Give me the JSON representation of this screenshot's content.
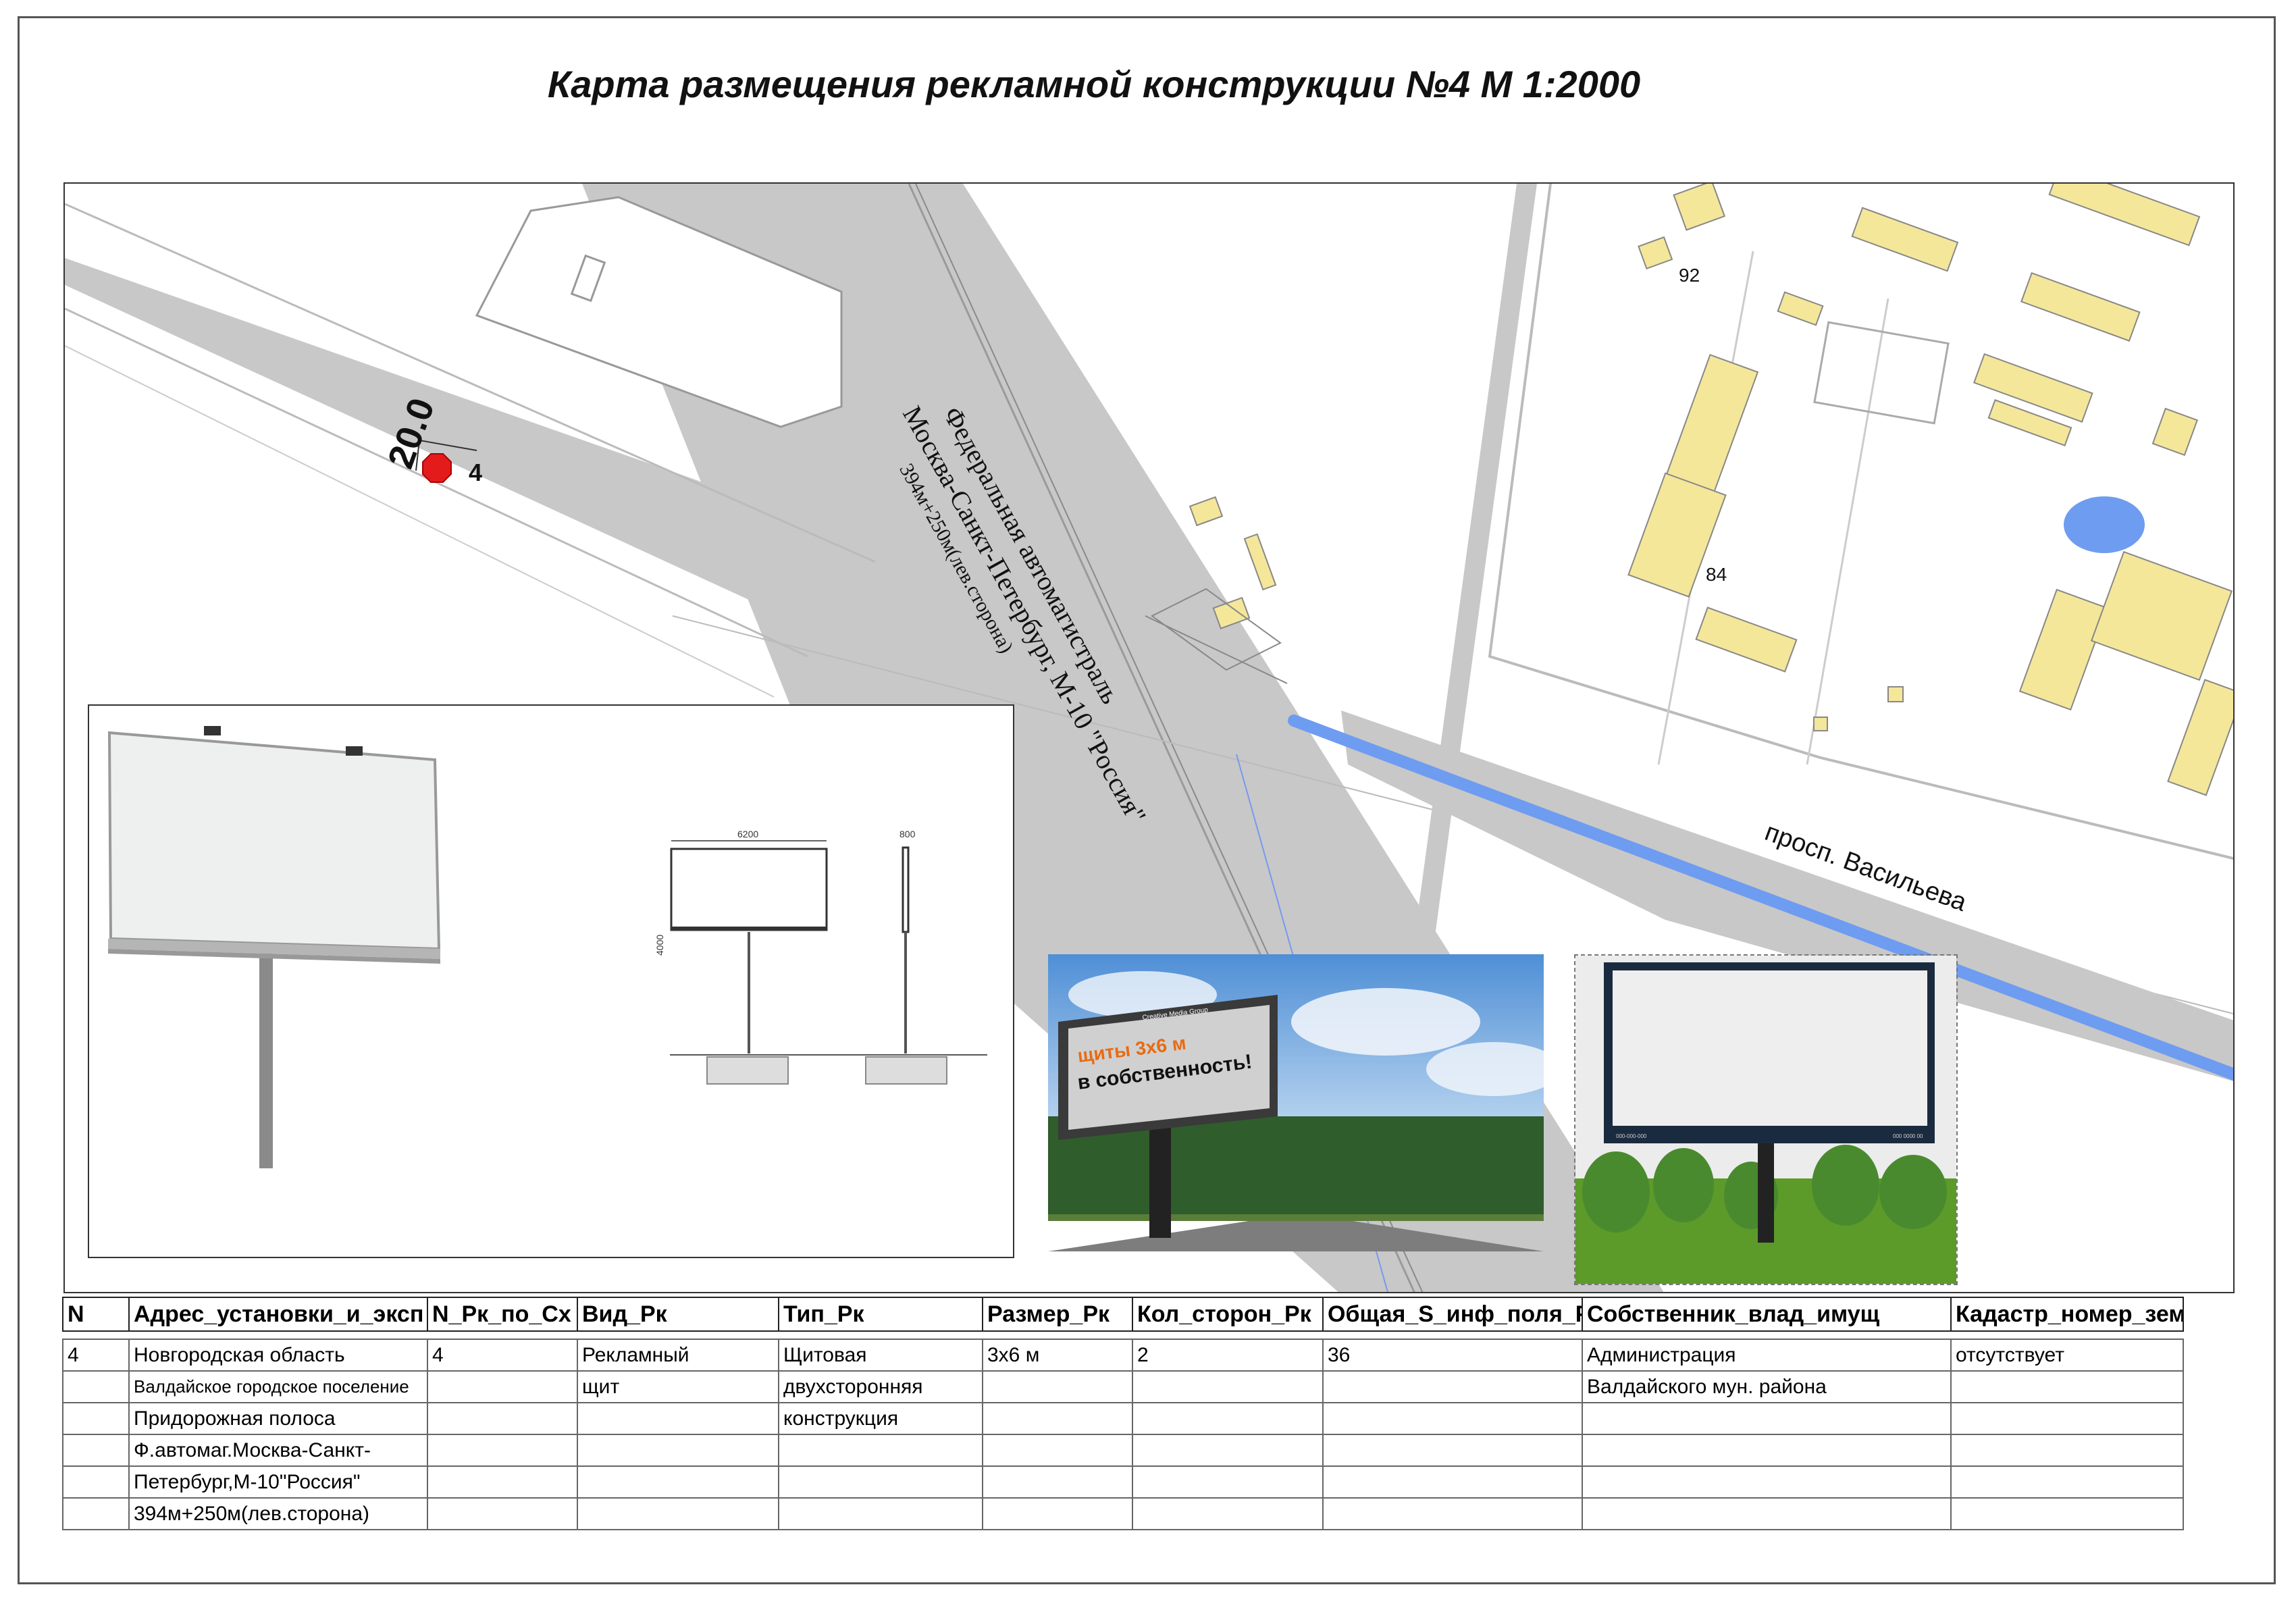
{
  "title": "Карта размещения рекламной конструкции №4 М 1:2000",
  "map": {
    "highway_label_1": "Федеральная автомагистраль",
    "highway_label_2": "Москва-Санкт-Петербург, М-10 \"Россия\"",
    "highway_label_3": "394м+250м(лев.сторона)",
    "street_label": "просп. Васильева",
    "distance_label": "20.0",
    "marker_number": "4",
    "house_92": "92",
    "house_84": "84",
    "marker_color": "#e41b1b",
    "road_gray": "#c8c8c8",
    "building_yellow": "#f5e79a",
    "water_blue": "#6e9cf0"
  },
  "drawing": {
    "dim_width": "6200",
    "dim_side": "800",
    "dim_height": "4000"
  },
  "photo_road": {
    "line1": "щиты 3х6 м",
    "line2": "в собственность!",
    "brand": "Creative Media Group"
  },
  "photo_field": {
    "footer_left": "000-000-000",
    "footer_right": "000 0000 00"
  },
  "table": {
    "headers": [
      "N",
      "Адрес_установки_и_эксп",
      "N_Рк_по_Сх",
      "Вид_Рк",
      "Тип_Рк",
      "Размер_Рк",
      "Кол_сторон_Рк",
      "Общая_S_инф_поля_Р",
      "Собственник_влад_имущ",
      "Кадастр_номер_зем_"
    ],
    "rows": [
      [
        "4",
        "Новгородская область",
        "4",
        "Рекламный",
        "Щитовая",
        "3х6 м",
        "2",
        "36",
        "Администрация",
        "отсутствует"
      ],
      [
        "",
        "Валдайское городское поселение",
        "",
        "щит",
        "двухсторонняя",
        "",
        "",
        "",
        "Валдайского мун. района",
        ""
      ],
      [
        "",
        "Придорожная полоса",
        "",
        "",
        "конструкция",
        "",
        "",
        "",
        "",
        ""
      ],
      [
        "",
        "Ф.автомаг.Москва-Санкт-",
        "",
        "",
        "",
        "",
        "",
        "",
        "",
        ""
      ],
      [
        "",
        "Петербург,М-10\"Россия\"",
        "",
        "",
        "",
        "",
        "",
        "",
        "",
        ""
      ],
      [
        "",
        "394м+250м(лев.сторона)",
        "",
        "",
        "",
        "",
        "",
        "",
        "",
        ""
      ]
    ]
  }
}
